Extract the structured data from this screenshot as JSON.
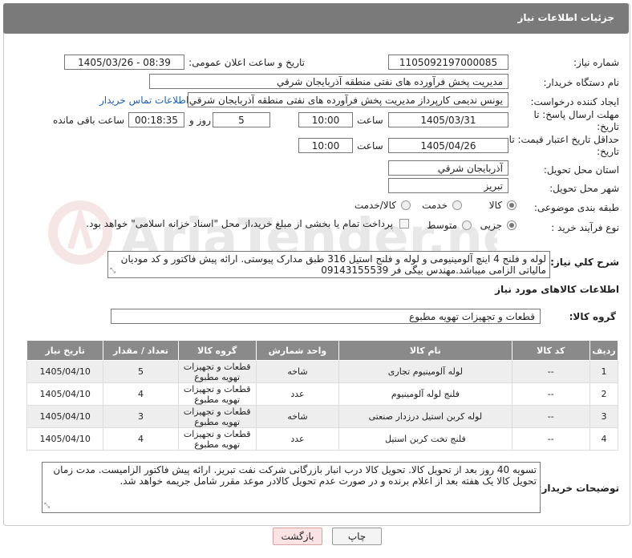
{
  "header": {
    "title": "جزئیات اطلاعات نیاز"
  },
  "fields": {
    "need_number_label": "شماره نیاز:",
    "need_number": "1105092197000085",
    "announce_label": "تاریخ و ساعت اعلان عمومی:",
    "announce_value": "1405/03/26 - 08:39",
    "buyer_label": "نام دستگاه خریدار:",
    "buyer_value": "مدیریت پخش فرآورده های نفتی منطقه آذربایجان شرقي",
    "creator_label": "ایجاد کننده درخواست:",
    "creator_value": "يونس نديمی كارپرداز مدیریت پخش فرآورده های نفتی منطقه آذربایجان شرقي",
    "contact_link": "اطلاعات تماس خریدار",
    "deadline_label": "مهلت ارسال پاسخ: تا تاریخ:",
    "deadline_date": "1405/03/31",
    "time_label": "ساعت",
    "deadline_time": "10:00",
    "days_value": "5",
    "days_label": "روز و",
    "remaining_time": "00:18:35",
    "remaining_label": "ساعت باقی مانده",
    "validity_label": "حداقل تاریخ اعتبار قیمت: تا تاریخ:",
    "validity_date": "1405/04/26",
    "validity_time": "10:00",
    "province_label": "استان محل تحویل:",
    "province_value": "آذربایجان شرقي",
    "city_label": "شهر محل تحویل:",
    "city_value": "تبریز",
    "category_label": "طبقه بندی موضوعی:",
    "category_options": [
      "کالا",
      "خدمت",
      "کالا/خدمت"
    ],
    "category_selected": "کالا",
    "process_label": "نوع فرآیند خرید :",
    "process_options": [
      "جزیی",
      "متوسط"
    ],
    "process_selected": "جزیی",
    "payment_note": "پرداخت تمام یا بخشی از مبلغ خرید،از محل \"اسناد خزانه اسلامی\" خواهد بود."
  },
  "description": {
    "label": "شرح کلي نياز:",
    "text": "لوله و فلنج 4 اینچ آلومینیومی و لوله و فلنج استیل 316 طبق مدارک پیوستی. ارائه پیش فاکتور و کد مودیان مالیاتی الزامی میباشد.مهندس بیگی فر 09143155539"
  },
  "goods": {
    "section_title": "اطلاعات کالاهای مورد نياز",
    "group_label": "گروه کالا:",
    "group_value": "قطعات و تجهیزات تهویه مطبوع",
    "columns": [
      "رديف",
      "کد کالا",
      "نام کالا",
      "واحد شمارش",
      "گروه کالا",
      "تعداد / مقدار",
      "تاريخ نياز"
    ],
    "rows": [
      {
        "idx": "1",
        "code": "--",
        "name": "لوله آلومینیوم تجاری",
        "unit": "شاخه",
        "group": "قطعات و تجهيزات تهويه مطبوع",
        "qty": "5",
        "date": "1405/04/10"
      },
      {
        "idx": "2",
        "code": "--",
        "name": "فلنج لوله آلومينيوم",
        "unit": "عدد",
        "group": "قطعات و تجهيزات تهويه مطبوع",
        "qty": "4",
        "date": "1405/04/10"
      },
      {
        "idx": "3",
        "code": "--",
        "name": "لوله کربن استیل درزدار صنعتی",
        "unit": "شاخه",
        "group": "قطعات و تجهيزات تهويه مطبوع",
        "qty": "3",
        "date": "1405/04/10"
      },
      {
        "idx": "4",
        "code": "--",
        "name": "فلنج تخت کربن استیل",
        "unit": "عدد",
        "group": "قطعات و تجهيزات تهويه مطبوع",
        "qty": "4",
        "date": "1405/04/10"
      }
    ]
  },
  "buyer_notes": {
    "label": "توضیحات خریدار:",
    "text": "تسویه 40 روز بعد از تحویل کالا. تحویل کالا درب انبار بازرگانی شرکت نفت تبریز. ارائه پیش فاکتور الزامیست. مدت زمان تحویل کالا یک هفته بعد از اعلام برنده و در صورت عدم تحویل کالادر موعد مقرر شامل جریمه خواهد شد."
  },
  "buttons": {
    "print": "چاپ",
    "back": "بازگشت"
  },
  "watermark": {
    "text": "AriaTender.net"
  },
  "colors": {
    "header_bg": "#7a7a7a",
    "table_header_bg": "#8a8a8a",
    "back_button_bg": "#fbe3e3",
    "link": "#1a5fb4"
  }
}
